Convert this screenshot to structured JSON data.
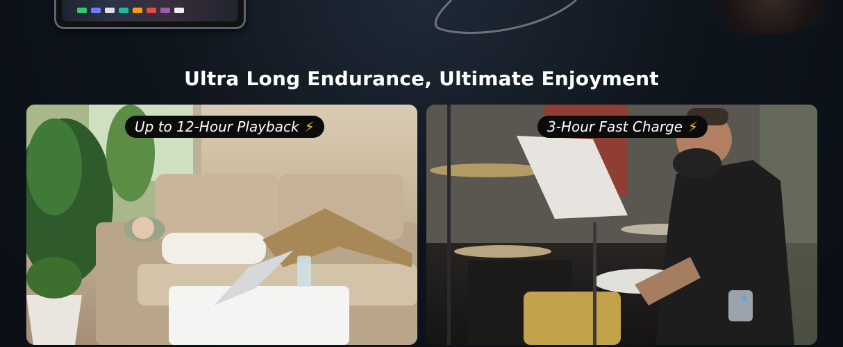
{
  "headline": "Ultra Long Endurance, Ultimate Enjoyment",
  "cards": [
    {
      "label": "Up to 12-Hour Playback",
      "icon": "lightning-bolt-icon",
      "glyph": "⚡"
    },
    {
      "label": "3-Hour Fast Charge",
      "icon": "lightning-bolt-icon",
      "glyph": "⚡"
    }
  ],
  "colors": {
    "background": "#0f151d",
    "pill": "#0b0b0b",
    "bolt": "#f5c518",
    "text": "#ffffff"
  }
}
